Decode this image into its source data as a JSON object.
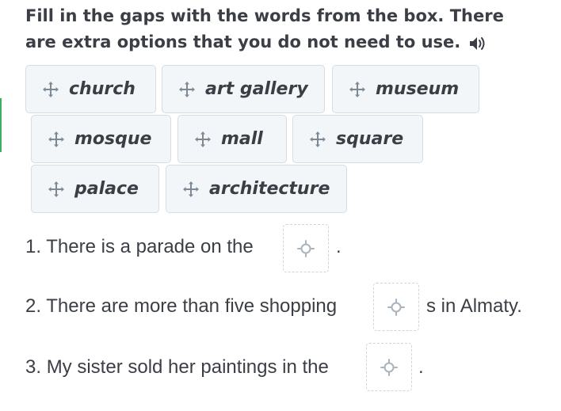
{
  "instruction": {
    "text": "Fill in the gaps with the words from the box. There are extra options that you do not need to use.",
    "audio_icon": "speaker-icon"
  },
  "word_bank": [
    {
      "label": "church",
      "icon": "move-icon"
    },
    {
      "label": "art gallery",
      "icon": "move-icon"
    },
    {
      "label": "museum",
      "icon": "move-icon"
    },
    {
      "label": "mosque",
      "icon": "move-icon"
    },
    {
      "label": "mall",
      "icon": "move-icon"
    },
    {
      "label": "square",
      "icon": "move-icon"
    },
    {
      "label": "palace",
      "icon": "move-icon"
    },
    {
      "label": "architecture",
      "icon": "move-icon"
    }
  ],
  "sentences": [
    {
      "number": "1.",
      "before": "There is a parade on the",
      "after": "."
    },
    {
      "number": "2.",
      "before": "There are more than five shopping",
      "after": "s in Almaty."
    },
    {
      "number": "3.",
      "before": "My sister sold her paintings in the",
      "after": "."
    }
  ],
  "colors": {
    "chip_background": "#f3f6f9",
    "chip_border": "#d5dde3",
    "text": "#3b3f45",
    "accent": "#3fae62"
  }
}
